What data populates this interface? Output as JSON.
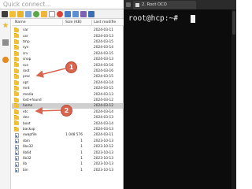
{
  "file_manager": {
    "quick_connect_placeholder": "Quick connect...",
    "columns": {
      "name": "Name",
      "size": "Size (KB)",
      "modified": "Last modifie"
    },
    "rows": [
      {
        "name": "var",
        "type": "folder",
        "size": "",
        "date": "2024-03-11"
      },
      {
        "name": "usr",
        "type": "folder",
        "size": "",
        "date": "2024-03-13"
      },
      {
        "name": "tmp",
        "type": "folder",
        "size": "",
        "date": "2024-03-15"
      },
      {
        "name": "sys",
        "type": "folder",
        "size": "",
        "date": "2024-03-14"
      },
      {
        "name": "srv",
        "type": "folder",
        "size": "",
        "date": "2024-03-15"
      },
      {
        "name": "snap",
        "type": "folder",
        "size": "",
        "date": "2024-03-13"
      },
      {
        "name": "run",
        "type": "folder",
        "size": "",
        "date": "2024-03-16"
      },
      {
        "name": "root",
        "type": "folder",
        "size": "",
        "date": "2024-03-16"
      },
      {
        "name": "proc",
        "type": "folder",
        "size": "",
        "date": "2024-03-15"
      },
      {
        "name": "opt",
        "type": "folder",
        "size": "",
        "date": "2024-03-14"
      },
      {
        "name": "mnt",
        "type": "folder",
        "size": "",
        "date": "2024-03-15"
      },
      {
        "name": "media",
        "type": "folder",
        "size": "",
        "date": "2024-03-13"
      },
      {
        "name": "lost+found",
        "type": "folder",
        "size": "",
        "date": "2024-03-12"
      },
      {
        "name": "home",
        "type": "folder",
        "size": "",
        "date": "2024-03-12"
      },
      {
        "name": "etc",
        "type": "folder",
        "size": "",
        "date": "2024-03-14"
      },
      {
        "name": "dev",
        "type": "folder",
        "size": "",
        "date": "2024-03-13"
      },
      {
        "name": "boot",
        "type": "folder",
        "size": "",
        "date": "2024-03-14"
      },
      {
        "name": "backup",
        "type": "folder",
        "size": "",
        "date": "2024-03-13"
      },
      {
        "name": "swapfile",
        "type": "file",
        "size": "1 048 576",
        "date": "2024-03-11"
      },
      {
        "name": "sbin",
        "type": "file",
        "size": "1",
        "date": "2023-10-13"
      },
      {
        "name": "libx32",
        "type": "file",
        "size": "1",
        "date": "2023-10-12"
      },
      {
        "name": "lib64",
        "type": "file",
        "size": "1",
        "date": "2023-10-13"
      },
      {
        "name": "lib32",
        "type": "file",
        "size": "1",
        "date": "2023-10-13"
      },
      {
        "name": "lib",
        "type": "file",
        "size": "1",
        "date": "2023-10-13"
      },
      {
        "name": "bin",
        "type": "file",
        "size": "1",
        "date": "2023-10-13"
      }
    ],
    "selected_row": "home"
  },
  "annotations": [
    {
      "number": "1"
    },
    {
      "number": "2"
    }
  ],
  "terminal": {
    "tab_label": "2. Root OCO",
    "prompt": "root@hcp:~#"
  },
  "colors": {
    "annotation": "#d9654f",
    "terminal_bg": "#0c0c0c",
    "folder": "#f2c037",
    "selected_row": "#cfcfcf"
  }
}
